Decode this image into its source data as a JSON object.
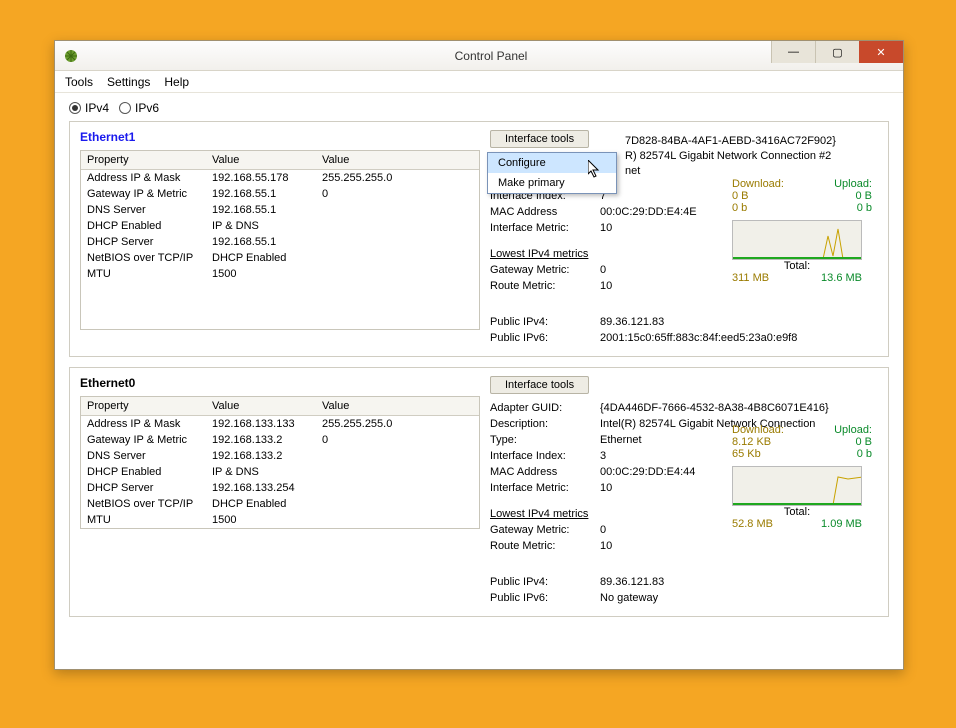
{
  "window": {
    "title": "Control Panel",
    "minimize": "—",
    "maximize": "▢",
    "close": "✕"
  },
  "menu": {
    "tools": "Tools",
    "settings": "Settings",
    "help": "Help"
  },
  "radios": {
    "ipv4": "IPv4",
    "ipv6": "IPv6"
  },
  "headers": {
    "property": "Property",
    "value1": "Value",
    "value2": "Value"
  },
  "buttons": {
    "interface_tools": "Interface tools"
  },
  "dropdown": {
    "configure": "Configure",
    "make_primary": "Make primary"
  },
  "rlabels": {
    "adapter_guid": "Adapter GUID:",
    "description": "Description:",
    "type": "Type:",
    "iface_index": "Interface Index:",
    "mac": "MAC Address",
    "iface_metric": "Interface Metric:",
    "download": "Download:",
    "upload": "Upload:",
    "lowest": "Lowest IPv4 metrics",
    "gw_metric": "Gateway Metric:",
    "route_metric": "Route Metric:",
    "total": "Total:",
    "public_v4": "Public IPv4:",
    "public_v6": "Public IPv6:"
  },
  "eth1": {
    "name": "Ethernet1",
    "rows": [
      {
        "p": "Address IP & Mask",
        "v1": "192.168.55.178",
        "v2": "255.255.255.0"
      },
      {
        "p": "Gateway IP & Metric",
        "v1": "192.168.55.1",
        "v2": "0"
      },
      {
        "p": "DNS Server",
        "v1": "192.168.55.1",
        "v2": ""
      },
      {
        "p": "DHCP Enabled",
        "v1": "IP & DNS",
        "v2": ""
      },
      {
        "p": "DHCP Server",
        "v1": "192.168.55.1",
        "v2": ""
      },
      {
        "p": "NetBIOS over TCP/IP",
        "v1": "DHCP Enabled",
        "v2": ""
      },
      {
        "p": "MTU",
        "v1": "1500",
        "v2": ""
      }
    ],
    "r": {
      "guid": "7D828-84BA-4AF1-AEBD-3416AC72F902}",
      "desc": "R) 82574L Gigabit Network Connection #2",
      "type_tail": "net",
      "iface_index": "7",
      "mac": "00:0C:29:DD:E4:4E",
      "iface_metric": "10",
      "dl": "0 B",
      "dl_rate": "0 b",
      "ul": "0 B",
      "ul_rate": "0 b",
      "gw_metric": "0",
      "route_metric": "10",
      "total_dl": "311 MB",
      "total_ul": "13.6 MB",
      "public_v4": "89.36.121.83",
      "public_v6": "2001:15c0:65ff:883c:84f:eed5:23a0:e9f8"
    }
  },
  "eth0": {
    "name": "Ethernet0",
    "rows": [
      {
        "p": "Address IP & Mask",
        "v1": "192.168.133.133",
        "v2": "255.255.255.0"
      },
      {
        "p": "Gateway IP & Metric",
        "v1": "192.168.133.2",
        "v2": "0"
      },
      {
        "p": "DNS Server",
        "v1": "192.168.133.2",
        "v2": ""
      },
      {
        "p": "DHCP Enabled",
        "v1": "IP & DNS",
        "v2": ""
      },
      {
        "p": "DHCP Server",
        "v1": "192.168.133.254",
        "v2": ""
      },
      {
        "p": "NetBIOS over TCP/IP",
        "v1": "DHCP Enabled",
        "v2": ""
      },
      {
        "p": "MTU",
        "v1": "1500",
        "v2": ""
      }
    ],
    "r": {
      "guid": "{4DA446DF-7666-4532-8A38-4B8C6071E416}",
      "desc": "Intel(R) 82574L Gigabit Network Connection",
      "type": "Ethernet",
      "iface_index": "3",
      "mac": "00:0C:29:DD:E4:44",
      "iface_metric": "10",
      "dl": "8.12 KB",
      "dl_rate": "65 Kb",
      "ul": "0 B",
      "ul_rate": "0 b",
      "gw_metric": "0",
      "route_metric": "10",
      "total_dl": "52.8 MB",
      "total_ul": "1.09 MB",
      "public_v4": "89.36.121.83",
      "public_v6": "No gateway"
    }
  }
}
